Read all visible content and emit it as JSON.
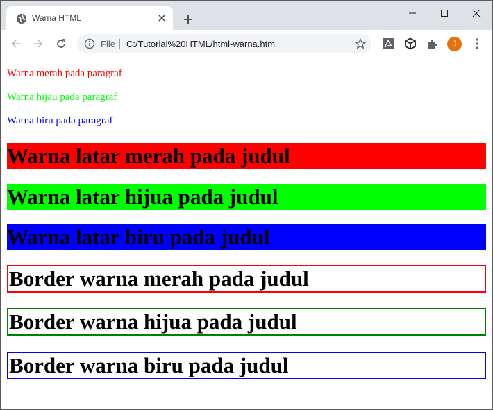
{
  "browser": {
    "tab_title": "Warna HTML",
    "scheme_label": "File",
    "url": "C:/Tutorial%20HTML/html-warna.htm",
    "avatar_initial": "J",
    "accent_color": "#e8710a"
  },
  "page": {
    "paragraphs": [
      {
        "text": "Warna merah pada paragraf",
        "color": "#ff0000"
      },
      {
        "text": "Warna hijau pada paragraf",
        "color": "#00ff00"
      },
      {
        "text": "Warna biru pada paragraf",
        "color": "#0000ff"
      }
    ],
    "bg_headings": [
      {
        "text": "Warna latar merah pada judul",
        "color": "#ff0000"
      },
      {
        "text": "Warna latar hijua pada judul",
        "color": "#00ff00"
      },
      {
        "text": "Warna latar biru pada judul",
        "color": "#0000ff"
      }
    ],
    "border_headings": [
      {
        "text": "Border warna merah pada judul",
        "color": "#ff0000"
      },
      {
        "text": "Border warna hijua pada judul",
        "color": "#008000"
      },
      {
        "text": "Border warna biru pada judul",
        "color": "#0000ff"
      }
    ]
  }
}
